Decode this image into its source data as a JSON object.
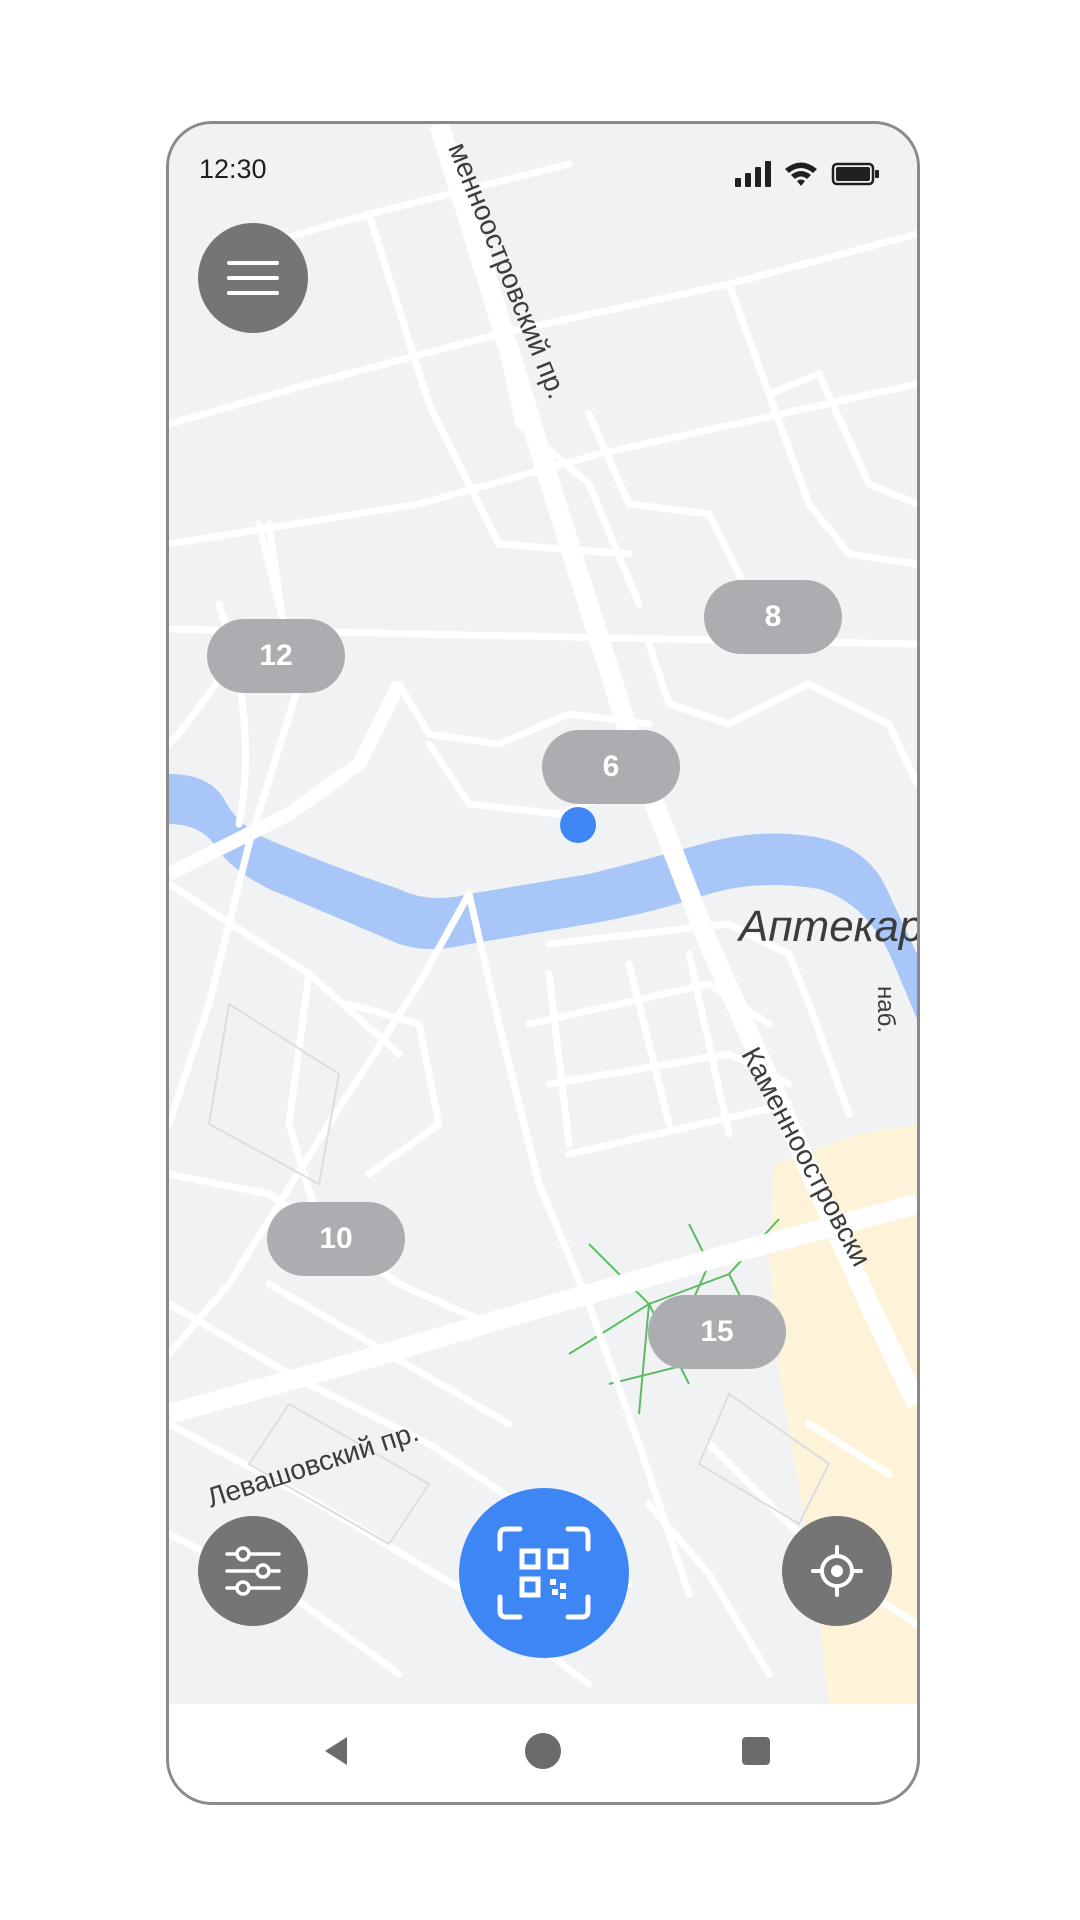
{
  "status_bar": {
    "time": "12:30",
    "icons": [
      "signal-icon",
      "wifi-icon",
      "battery-icon"
    ]
  },
  "map": {
    "street_labels": {
      "kamennoostrovsky_top": "менноостровский пр.",
      "kamennoostrovsky_bottom": "Каменноостровски",
      "levashovsky": "Левашовский пр.",
      "aptekarsky": "Аптекар",
      "naberezhnaya": "наб."
    },
    "clusters": [
      {
        "id": "cluster-12",
        "count": "12"
      },
      {
        "id": "cluster-8",
        "count": "8"
      },
      {
        "id": "cluster-6",
        "count": "6"
      },
      {
        "id": "cluster-10",
        "count": "10"
      },
      {
        "id": "cluster-15",
        "count": "15"
      }
    ]
  },
  "buttons": {
    "menu": "menu-icon",
    "filter": "filter-sliders-icon",
    "scan": "qr-scan-icon",
    "locate": "locate-crosshair-icon"
  },
  "nav": {
    "back": "back-triangle-icon",
    "home": "home-circle-icon",
    "recents": "recents-square-icon"
  },
  "colors": {
    "accent": "#3d86f4",
    "fab_gray": "#757575",
    "cluster_gray": "#acadb0",
    "water": "#a8c6f7",
    "park": "#fcf3d9",
    "map_bg": "#f1f2f4"
  }
}
